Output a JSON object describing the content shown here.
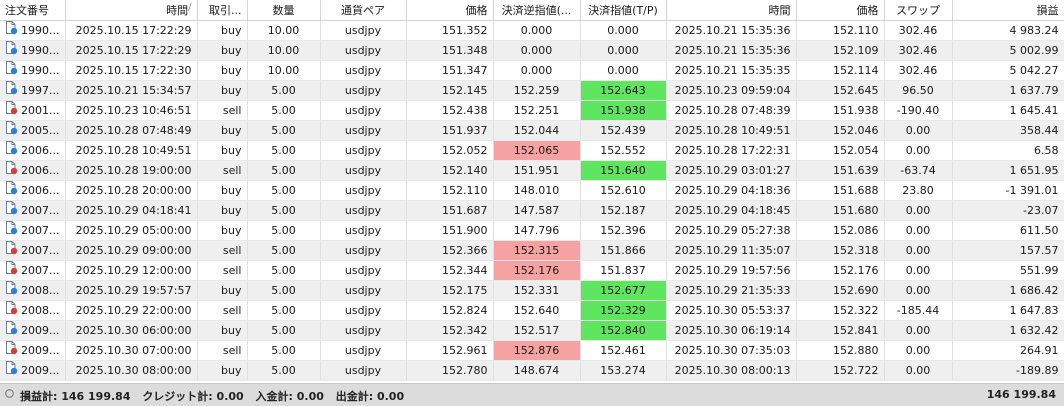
{
  "columns": [
    {
      "label": "注文番号",
      "align": "l",
      "width": 65
    },
    {
      "label": "時間",
      "align": "r",
      "width": 132,
      "sort": "/"
    },
    {
      "label": "取引...",
      "align": "r",
      "width": 50
    },
    {
      "label": "数量",
      "align": "c",
      "width": 73
    },
    {
      "label": "通貨ペア",
      "align": "c",
      "width": 86
    },
    {
      "label": "価格",
      "align": "r",
      "width": 87
    },
    {
      "label": "決済逆指値(...",
      "align": "c",
      "width": 87
    },
    {
      "label": "決済指値(T/P)",
      "align": "c",
      "width": 86
    },
    {
      "label": "時間",
      "align": "r",
      "width": 130
    },
    {
      "label": "価格",
      "align": "r",
      "width": 88
    },
    {
      "label": "スワップ",
      "align": "c",
      "width": 68
    },
    {
      "label": "損益",
      "align": "r",
      "width": 112
    }
  ],
  "rows": [
    {
      "icon": "buy",
      "cells": [
        "1990...",
        "2025.10.15 17:22:29",
        "buy",
        "10.00",
        "usdjpy",
        "151.352",
        "0.000",
        "0.000",
        "2025.10.21 15:35:36",
        "152.110",
        "302.46",
        "4 983.24"
      ]
    },
    {
      "icon": "buy",
      "cells": [
        "1990...",
        "2025.10.15 17:22:29",
        "buy",
        "10.00",
        "usdjpy",
        "151.348",
        "0.000",
        "0.000",
        "2025.10.21 15:35:36",
        "152.109",
        "302.46",
        "5 002.99"
      ]
    },
    {
      "icon": "buy",
      "cells": [
        "1990...",
        "2025.10.15 17:22:30",
        "buy",
        "10.00",
        "usdjpy",
        "151.347",
        "0.000",
        "0.000",
        "2025.10.21 15:35:35",
        "152.114",
        "302.46",
        "5 042.27"
      ]
    },
    {
      "icon": "buy",
      "tp": "green",
      "cells": [
        "1997...",
        "2025.10.21 15:34:57",
        "buy",
        "5.00",
        "usdjpy",
        "152.145",
        "152.259",
        "152.643",
        "2025.10.23 09:59:04",
        "152.645",
        "96.50",
        "1 637.79"
      ]
    },
    {
      "icon": "sell",
      "tp": "green",
      "cells": [
        "2001...",
        "2025.10.23 10:46:51",
        "sell",
        "5.00",
        "usdjpy",
        "152.438",
        "152.251",
        "151.938",
        "2025.10.28 07:48:39",
        "151.938",
        "-190.40",
        "1 645.41"
      ]
    },
    {
      "icon": "buy",
      "cells": [
        "2005...",
        "2025.10.28 07:48:49",
        "buy",
        "5.00",
        "usdjpy",
        "151.937",
        "152.044",
        "152.439",
        "2025.10.28 10:49:51",
        "152.046",
        "0.00",
        "358.44"
      ]
    },
    {
      "icon": "buy",
      "sl": "red",
      "cells": [
        "2006...",
        "2025.10.28 10:49:51",
        "buy",
        "5.00",
        "usdjpy",
        "152.052",
        "152.065",
        "152.552",
        "2025.10.28 17:22:31",
        "152.054",
        "0.00",
        "6.58"
      ]
    },
    {
      "icon": "sell",
      "tp": "green",
      "cells": [
        "2006...",
        "2025.10.28 19:00:00",
        "sell",
        "5.00",
        "usdjpy",
        "152.140",
        "151.951",
        "151.640",
        "2025.10.29 03:01:27",
        "151.639",
        "-63.74",
        "1 651.95"
      ]
    },
    {
      "icon": "buy",
      "cells": [
        "2006...",
        "2025.10.28 20:00:00",
        "buy",
        "5.00",
        "usdjpy",
        "152.110",
        "148.010",
        "152.610",
        "2025.10.29 04:18:36",
        "151.688",
        "23.80",
        "-1 391.01"
      ]
    },
    {
      "icon": "buy",
      "cells": [
        "2007...",
        "2025.10.29 04:18:41",
        "buy",
        "5.00",
        "usdjpy",
        "151.687",
        "147.587",
        "152.187",
        "2025.10.29 04:18:45",
        "151.680",
        "0.00",
        "-23.07"
      ]
    },
    {
      "icon": "buy",
      "cells": [
        "2007...",
        "2025.10.29 05:00:00",
        "buy",
        "5.00",
        "usdjpy",
        "151.900",
        "147.796",
        "152.396",
        "2025.10.29 05:27:38",
        "152.086",
        "0.00",
        "611.50"
      ]
    },
    {
      "icon": "sell",
      "sl": "red",
      "cells": [
        "2007...",
        "2025.10.29 09:00:00",
        "sell",
        "5.00",
        "usdjpy",
        "152.366",
        "152.315",
        "151.866",
        "2025.10.29 11:35:07",
        "152.318",
        "0.00",
        "157.57"
      ]
    },
    {
      "icon": "sell",
      "sl": "red",
      "cells": [
        "2007...",
        "2025.10.29 12:00:00",
        "sell",
        "5.00",
        "usdjpy",
        "152.344",
        "152.176",
        "151.837",
        "2025.10.29 19:57:56",
        "152.176",
        "0.00",
        "551.99"
      ]
    },
    {
      "icon": "buy",
      "tp": "green",
      "cells": [
        "2008...",
        "2025.10.29 19:57:57",
        "buy",
        "5.00",
        "usdjpy",
        "152.175",
        "152.331",
        "152.677",
        "2025.10.29 21:35:33",
        "152.690",
        "0.00",
        "1 686.42"
      ]
    },
    {
      "icon": "sell",
      "tp": "green",
      "cells": [
        "2008...",
        "2025.10.29 22:00:00",
        "sell",
        "5.00",
        "usdjpy",
        "152.824",
        "152.640",
        "152.329",
        "2025.10.30 05:53:37",
        "152.322",
        "-185.44",
        "1 647.83"
      ]
    },
    {
      "icon": "buy",
      "tp": "green",
      "cells": [
        "2009...",
        "2025.10.30 06:00:00",
        "buy",
        "5.00",
        "usdjpy",
        "152.342",
        "152.517",
        "152.840",
        "2025.10.30 06:19:14",
        "152.841",
        "0.00",
        "1 632.42"
      ]
    },
    {
      "icon": "sell",
      "sl": "red",
      "cells": [
        "2009...",
        "2025.10.30 07:00:00",
        "sell",
        "5.00",
        "usdjpy",
        "152.961",
        "152.876",
        "152.461",
        "2025.10.30 07:35:03",
        "152.880",
        "0.00",
        "264.91"
      ]
    },
    {
      "icon": "buy",
      "cells": [
        "2009...",
        "2025.10.30 08:00:00",
        "buy",
        "5.00",
        "usdjpy",
        "152.780",
        "148.674",
        "153.274",
        "2025.10.30 08:00:13",
        "152.722",
        "0.00",
        "-189.89"
      ]
    }
  ],
  "footer": {
    "summary": [
      "損益計: 146 199.84",
      "クレジット計: 0.00",
      "入金計: 0.00",
      "出金計: 0.00"
    ],
    "total": "146 199.84"
  },
  "colors": {
    "tp_highlight": "#5ee65e",
    "sl_highlight": "#f7a2a2",
    "buy_icon": "#2f7fd6",
    "sell_icon": "#d93a3a"
  },
  "icons": {
    "row": "document-icon",
    "footer": "circle-icon"
  }
}
